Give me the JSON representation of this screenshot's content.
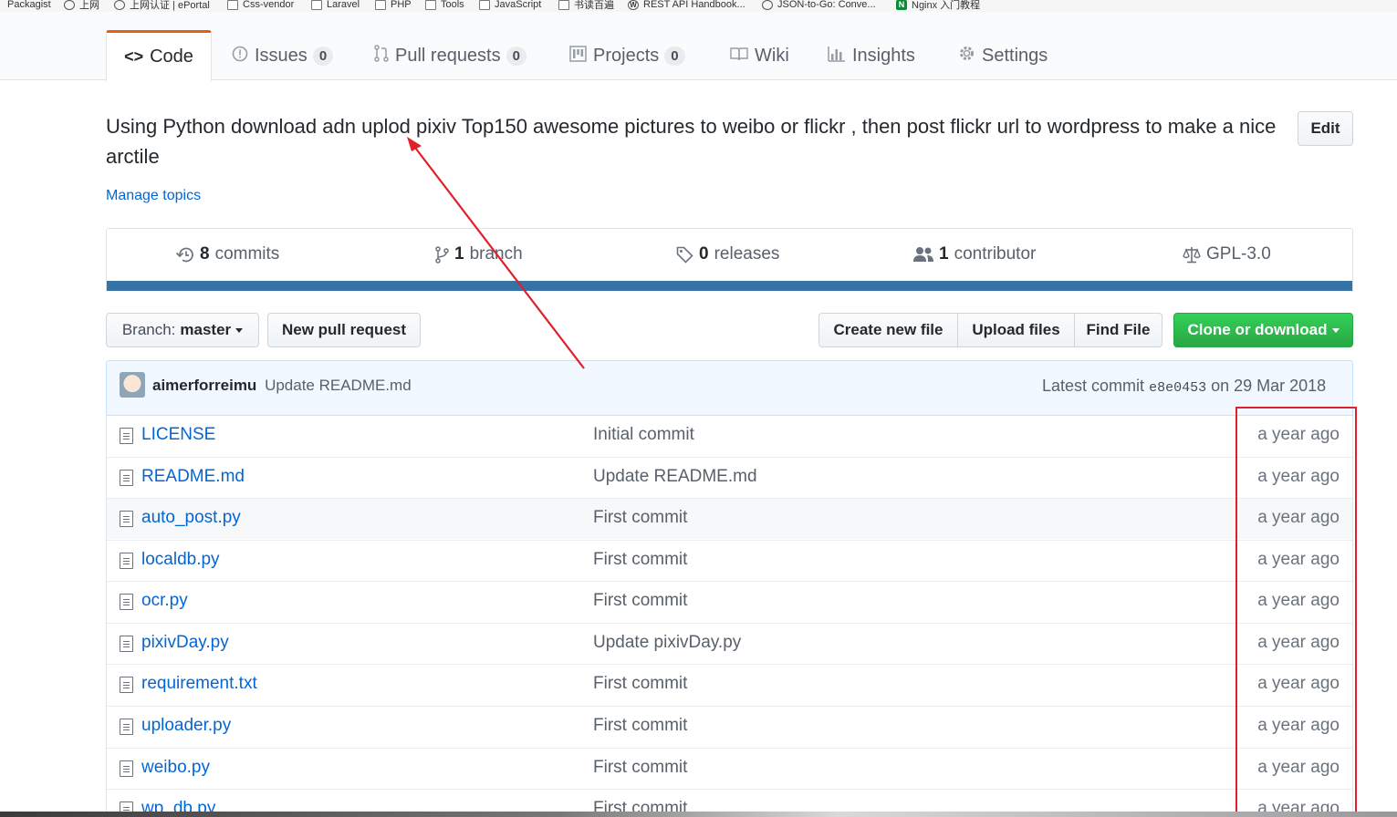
{
  "bookmarks": [
    {
      "label": "Packagist",
      "icon": "globe-icon"
    },
    {
      "label": "上网",
      "icon": "globe-icon"
    },
    {
      "label": "上网认证 | ePortal",
      "icon": "globe-icon"
    },
    {
      "label": "Css-vendor",
      "icon": "folder-icon"
    },
    {
      "label": "Laravel",
      "icon": "folder-icon"
    },
    {
      "label": "PHP",
      "icon": "folder-icon"
    },
    {
      "label": "Tools",
      "icon": "folder-icon"
    },
    {
      "label": "JavaScript",
      "icon": "folder-icon"
    },
    {
      "label": "书读百遍",
      "icon": "folder-icon"
    },
    {
      "label": "REST API Handbook...",
      "icon": "wordpress-icon"
    },
    {
      "label": "JSON-to-Go: Conve...",
      "icon": "globe-icon"
    },
    {
      "label": "Nginx 入门教程",
      "icon": "nginx-icon"
    }
  ],
  "nav": {
    "code": "Code",
    "issues": "Issues",
    "issues_count": "0",
    "pulls": "Pull requests",
    "pulls_count": "0",
    "projects": "Projects",
    "projects_count": "0",
    "wiki": "Wiki",
    "insights": "Insights",
    "settings": "Settings"
  },
  "repo": {
    "description": "Using Python download adn uplod pixiv Top150 awesome pictures to weibo or flickr , then post flickr url to wordpress to make a nice arctile",
    "edit_label": "Edit",
    "manage_topics": "Manage topics"
  },
  "summary": {
    "commits_count": "8",
    "commits_label": "commits",
    "branch_count": "1",
    "branch_label": "branch",
    "releases_count": "0",
    "releases_label": "releases",
    "contributors_count": "1",
    "contributors_label": "contributor",
    "license": "GPL-3.0",
    "language_color": "#3572a5"
  },
  "toolbar": {
    "branch_prefix": "Branch:",
    "branch_name": "master",
    "new_pull_request": "New pull request",
    "create_new_file": "Create new file",
    "upload_files": "Upload files",
    "find_file": "Find File",
    "clone_or_download": "Clone or download"
  },
  "commit_tease": {
    "author": "aimerforreimu",
    "message": "Update README.md",
    "latest_prefix": "Latest commit",
    "sha": "e8e0453",
    "date": "on 29 Mar 2018"
  },
  "files": [
    {
      "name": "LICENSE",
      "message": "Initial commit",
      "age": "a year ago"
    },
    {
      "name": "README.md",
      "message": "Update README.md",
      "age": "a year ago"
    },
    {
      "name": "auto_post.py",
      "message": "First commit",
      "age": "a year ago"
    },
    {
      "name": "localdb.py",
      "message": "First commit",
      "age": "a year ago"
    },
    {
      "name": "ocr.py",
      "message": "First commit",
      "age": "a year ago"
    },
    {
      "name": "pixivDay.py",
      "message": "Update pixivDay.py",
      "age": "a year ago"
    },
    {
      "name": "requirement.txt",
      "message": "First commit",
      "age": "a year ago"
    },
    {
      "name": "uploader.py",
      "message": "First commit",
      "age": "a year ago"
    },
    {
      "name": "weibo.py",
      "message": "First commit",
      "age": "a year ago"
    },
    {
      "name": "wp_db.py",
      "message": "First commit",
      "age": "a year ago"
    }
  ],
  "annotation_color": "#e0202a"
}
